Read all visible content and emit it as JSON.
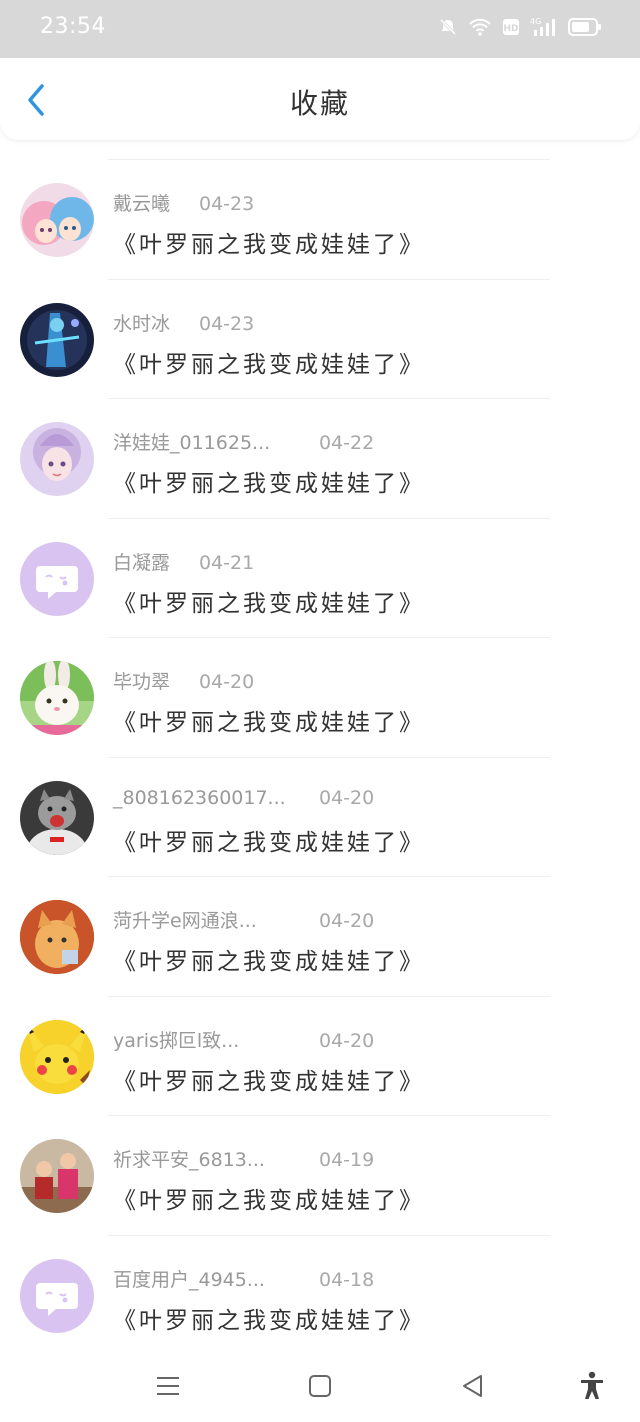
{
  "status_bar": {
    "time": "23:54",
    "network": "4G"
  },
  "header": {
    "title": "收藏"
  },
  "colors": {
    "accent": "#2f95e0",
    "placeholder_avatar": "#d9c3f0"
  },
  "items": [
    {
      "name": "戴云曦",
      "date": "04-23",
      "title": "《叶罗丽之我变成娃娃了》",
      "avatar": "anime-girls"
    },
    {
      "name": "水时冰",
      "date": "04-23",
      "title": "《叶罗丽之我变成娃娃了》",
      "avatar": "dark-fantasy"
    },
    {
      "name": "洋娃娃_011625...",
      "date": "04-22",
      "title": "《叶罗丽之我变成娃娃了》",
      "avatar": "doll-girl"
    },
    {
      "name": "白凝露",
      "date": "04-21",
      "title": "《叶罗丽之我变成娃娃了》",
      "avatar": "default"
    },
    {
      "name": "毕功翠",
      "date": "04-20",
      "title": "《叶罗丽之我变成娃娃了》",
      "avatar": "rabbit"
    },
    {
      "name": "_808162360017...",
      "date": "04-20",
      "title": "《叶罗丽之我变成娃娃了》",
      "avatar": "cat-hoodie"
    },
    {
      "name": "菏升学e网通浪...",
      "date": "04-20",
      "title": "《叶罗丽之我变成娃娃了》",
      "avatar": "cat-orange"
    },
    {
      "name": "yaris掷叵l致...",
      "date": "04-20",
      "title": "《叶罗丽之我变成娃娃了》",
      "avatar": "pikachu"
    },
    {
      "name": "祈求平安_6813...",
      "date": "04-19",
      "title": "《叶罗丽之我变成娃娃了》",
      "avatar": "kids-photo"
    },
    {
      "name": "百度用户_4945...",
      "date": "04-18",
      "title": "《叶罗丽之我变成娃娃了》",
      "avatar": "default"
    }
  ]
}
